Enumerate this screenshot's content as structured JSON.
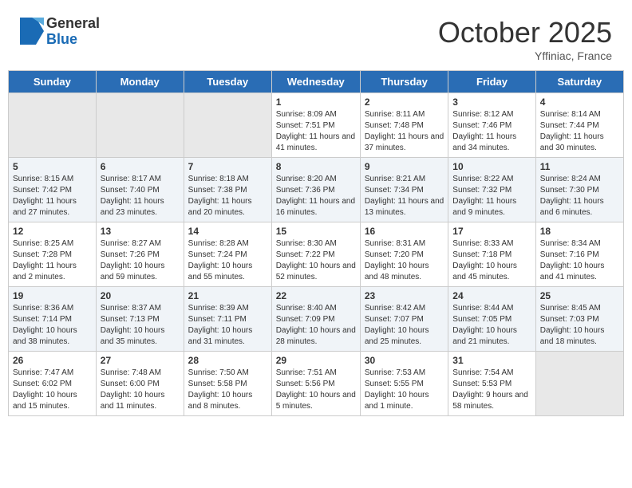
{
  "logo": {
    "general": "General",
    "blue": "Blue"
  },
  "title": "October 2025",
  "subtitle": "Yffiniac, France",
  "days_of_week": [
    "Sunday",
    "Monday",
    "Tuesday",
    "Wednesday",
    "Thursday",
    "Friday",
    "Saturday"
  ],
  "weeks": [
    [
      {
        "day": "",
        "detail": ""
      },
      {
        "day": "",
        "detail": ""
      },
      {
        "day": "",
        "detail": ""
      },
      {
        "day": "1",
        "detail": "Sunrise: 8:09 AM\nSunset: 7:51 PM\nDaylight: 11 hours and 41 minutes."
      },
      {
        "day": "2",
        "detail": "Sunrise: 8:11 AM\nSunset: 7:48 PM\nDaylight: 11 hours and 37 minutes."
      },
      {
        "day": "3",
        "detail": "Sunrise: 8:12 AM\nSunset: 7:46 PM\nDaylight: 11 hours and 34 minutes."
      },
      {
        "day": "4",
        "detail": "Sunrise: 8:14 AM\nSunset: 7:44 PM\nDaylight: 11 hours and 30 minutes."
      }
    ],
    [
      {
        "day": "5",
        "detail": "Sunrise: 8:15 AM\nSunset: 7:42 PM\nDaylight: 11 hours and 27 minutes."
      },
      {
        "day": "6",
        "detail": "Sunrise: 8:17 AM\nSunset: 7:40 PM\nDaylight: 11 hours and 23 minutes."
      },
      {
        "day": "7",
        "detail": "Sunrise: 8:18 AM\nSunset: 7:38 PM\nDaylight: 11 hours and 20 minutes."
      },
      {
        "day": "8",
        "detail": "Sunrise: 8:20 AM\nSunset: 7:36 PM\nDaylight: 11 hours and 16 minutes."
      },
      {
        "day": "9",
        "detail": "Sunrise: 8:21 AM\nSunset: 7:34 PM\nDaylight: 11 hours and 13 minutes."
      },
      {
        "day": "10",
        "detail": "Sunrise: 8:22 AM\nSunset: 7:32 PM\nDaylight: 11 hours and 9 minutes."
      },
      {
        "day": "11",
        "detail": "Sunrise: 8:24 AM\nSunset: 7:30 PM\nDaylight: 11 hours and 6 minutes."
      }
    ],
    [
      {
        "day": "12",
        "detail": "Sunrise: 8:25 AM\nSunset: 7:28 PM\nDaylight: 11 hours and 2 minutes."
      },
      {
        "day": "13",
        "detail": "Sunrise: 8:27 AM\nSunset: 7:26 PM\nDaylight: 10 hours and 59 minutes."
      },
      {
        "day": "14",
        "detail": "Sunrise: 8:28 AM\nSunset: 7:24 PM\nDaylight: 10 hours and 55 minutes."
      },
      {
        "day": "15",
        "detail": "Sunrise: 8:30 AM\nSunset: 7:22 PM\nDaylight: 10 hours and 52 minutes."
      },
      {
        "day": "16",
        "detail": "Sunrise: 8:31 AM\nSunset: 7:20 PM\nDaylight: 10 hours and 48 minutes."
      },
      {
        "day": "17",
        "detail": "Sunrise: 8:33 AM\nSunset: 7:18 PM\nDaylight: 10 hours and 45 minutes."
      },
      {
        "day": "18",
        "detail": "Sunrise: 8:34 AM\nSunset: 7:16 PM\nDaylight: 10 hours and 41 minutes."
      }
    ],
    [
      {
        "day": "19",
        "detail": "Sunrise: 8:36 AM\nSunset: 7:14 PM\nDaylight: 10 hours and 38 minutes."
      },
      {
        "day": "20",
        "detail": "Sunrise: 8:37 AM\nSunset: 7:13 PM\nDaylight: 10 hours and 35 minutes."
      },
      {
        "day": "21",
        "detail": "Sunrise: 8:39 AM\nSunset: 7:11 PM\nDaylight: 10 hours and 31 minutes."
      },
      {
        "day": "22",
        "detail": "Sunrise: 8:40 AM\nSunset: 7:09 PM\nDaylight: 10 hours and 28 minutes."
      },
      {
        "day": "23",
        "detail": "Sunrise: 8:42 AM\nSunset: 7:07 PM\nDaylight: 10 hours and 25 minutes."
      },
      {
        "day": "24",
        "detail": "Sunrise: 8:44 AM\nSunset: 7:05 PM\nDaylight: 10 hours and 21 minutes."
      },
      {
        "day": "25",
        "detail": "Sunrise: 8:45 AM\nSunset: 7:03 PM\nDaylight: 10 hours and 18 minutes."
      }
    ],
    [
      {
        "day": "26",
        "detail": "Sunrise: 7:47 AM\nSunset: 6:02 PM\nDaylight: 10 hours and 15 minutes."
      },
      {
        "day": "27",
        "detail": "Sunrise: 7:48 AM\nSunset: 6:00 PM\nDaylight: 10 hours and 11 minutes."
      },
      {
        "day": "28",
        "detail": "Sunrise: 7:50 AM\nSunset: 5:58 PM\nDaylight: 10 hours and 8 minutes."
      },
      {
        "day": "29",
        "detail": "Sunrise: 7:51 AM\nSunset: 5:56 PM\nDaylight: 10 hours and 5 minutes."
      },
      {
        "day": "30",
        "detail": "Sunrise: 7:53 AM\nSunset: 5:55 PM\nDaylight: 10 hours and 1 minute."
      },
      {
        "day": "31",
        "detail": "Sunrise: 7:54 AM\nSunset: 5:53 PM\nDaylight: 9 hours and 58 minutes."
      },
      {
        "day": "",
        "detail": ""
      }
    ]
  ]
}
